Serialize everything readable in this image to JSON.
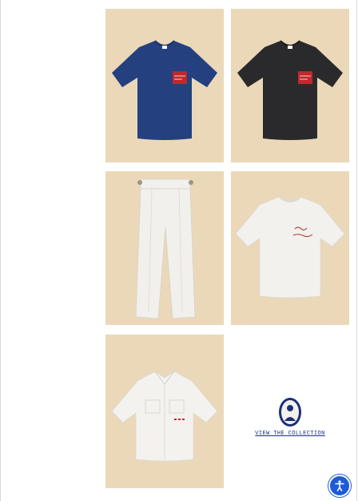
{
  "products": [
    {
      "name": "navy-pocket-tee",
      "shirt_color": "#24407f",
      "accent_color": "#c0282d"
    },
    {
      "name": "black-pocket-tee",
      "shirt_color": "#2a2a2c",
      "accent_color": "#c0282d"
    },
    {
      "name": "white-trousers",
      "shirt_color": "#f1f0ec"
    },
    {
      "name": "white-script-tee",
      "shirt_color": "#f2f1ee",
      "accent_color": "#b02a30"
    },
    {
      "name": "white-safari-shirt",
      "shirt_color": "#f3f2ef",
      "accent_color": "#c0282d"
    }
  ],
  "tile_background": "#ead8b9",
  "collection": {
    "link_text": "VIEW THE COLLECTION",
    "emblem": "portrait-cameo-icon"
  },
  "accessibility": {
    "icon": "accessibility-icon",
    "color": "#1d5bd8"
  }
}
